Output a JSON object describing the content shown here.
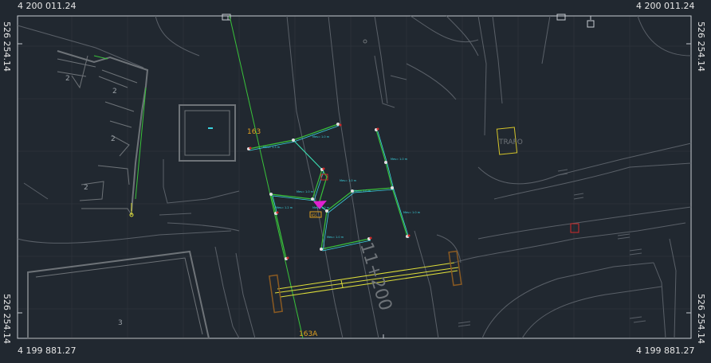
{
  "coords": {
    "top_left": "4 200 011.24",
    "top_right": "4 200 011.24",
    "bottom_left": "4 199 881.27",
    "bottom_right": "4 199 881.27",
    "left_top": "526 254.14",
    "left_bottom": "526 254.14",
    "right_top": "526 254.14",
    "right_bottom": "526 254.14"
  },
  "labels": {
    "block_a": "2",
    "block_b": "2",
    "block_c": "2",
    "block_d": "2",
    "block_e": "3",
    "line_163": "163",
    "line_163a": "163A",
    "trafo": "TRAFO",
    "chainage": "11+200",
    "node_tag": "K5C",
    "dist_1": "Mes= 1.3 m",
    "dist_2": "Mes= 1.0 m",
    "dist_3": "Mes= 1.0 m",
    "dist_4": "Mes= 1.2 m",
    "dist_5": "Mes= 1.0 m",
    "dist_6": "Mes= 1.0 m",
    "dist_7": "Mes= 1.0 m",
    "dist_8": "Mes= 1.0 m",
    "dist_9": "Mes= 1.0 m",
    "dist_10": "Mes= 1.0 m"
  },
  "colors": {
    "background": "#212830",
    "frame": "#c8ccd2",
    "building": "#6e7378",
    "road": "#5a6068",
    "grid": "#2a3139",
    "network_green": "#39c23a",
    "cable_cyan": "#3ad3e0",
    "axis_yellow": "#dede3a",
    "label_orange": "#e0a020",
    "trafo_yellow": "#d4c42a",
    "red_marker": "#d02a2a",
    "magenta": "#e020d0",
    "brown": "#8a5a22"
  }
}
